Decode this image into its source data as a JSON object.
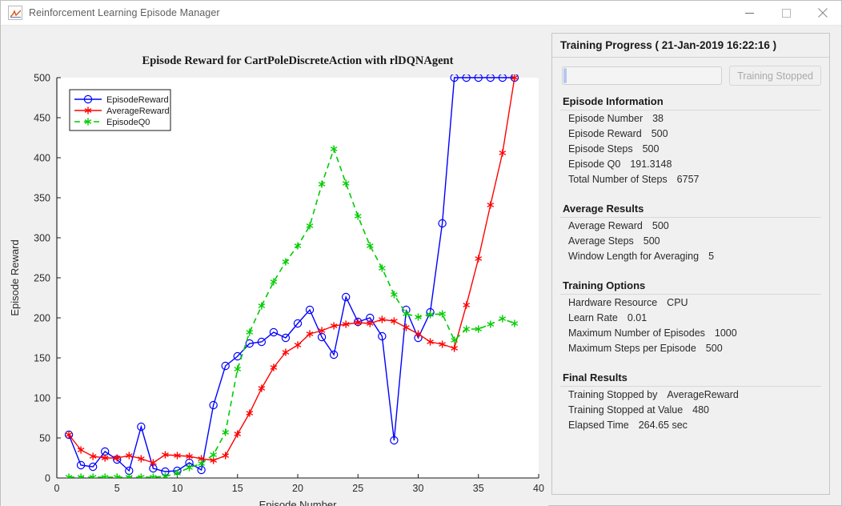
{
  "window": {
    "title": "Reinforcement Learning Episode Manager",
    "app_icon": "matlab-figure-icon",
    "minimize_label": "—",
    "maximize_label": "□",
    "close_label": "✕"
  },
  "panel": {
    "header": "Training Progress ( 21-Jan-2019 16:22:16 )",
    "progress_percent": 2,
    "stop_button_label": "Training Stopped",
    "sections": [
      {
        "title": "Episode Information",
        "rows": [
          {
            "key": "Episode Number",
            "value": "38"
          },
          {
            "key": "Episode Reward",
            "value": "500"
          },
          {
            "key": "Episode Steps",
            "value": "500"
          },
          {
            "key": "Episode Q0",
            "value": "191.3148"
          },
          {
            "key": "Total Number of Steps",
            "value": "6757"
          }
        ]
      },
      {
        "title": "Average Results",
        "rows": [
          {
            "key": "Average Reward",
            "value": "500"
          },
          {
            "key": "Average Steps",
            "value": "500"
          },
          {
            "key": "Window Length for Averaging",
            "value": "5"
          }
        ]
      },
      {
        "title": "Training Options",
        "rows": [
          {
            "key": "Hardware Resource",
            "value": "CPU"
          },
          {
            "key": "Learn Rate",
            "value": "0.01"
          },
          {
            "key": "Maximum Number of Episodes",
            "value": "1000"
          },
          {
            "key": "Maximum Steps per Episode",
            "value": "500"
          }
        ]
      },
      {
        "title": "Final Results",
        "rows": [
          {
            "key": "Training Stopped by",
            "value": "AverageReward"
          },
          {
            "key": "Training Stopped at Value",
            "value": "480"
          },
          {
            "key": "Elapsed Time",
            "value": "264.65 sec"
          }
        ]
      }
    ]
  },
  "chart_data": {
    "type": "line",
    "title": "Episode Reward for CartPoleDiscreteAction with rlDQNAgent",
    "xlabel": "Episode Number",
    "ylabel": "Episode Reward",
    "xlim": [
      0,
      40
    ],
    "ylim": [
      0,
      500
    ],
    "xticks": [
      0,
      5,
      10,
      15,
      20,
      25,
      30,
      35,
      40
    ],
    "yticks": [
      0,
      50,
      100,
      150,
      200,
      250,
      300,
      350,
      400,
      450,
      500
    ],
    "grid": false,
    "legend_position": "upper-left",
    "colors": {
      "EpisodeReward": "#0000ff",
      "AverageReward": "#ff0000",
      "EpisodeQ0": "#00cc00"
    },
    "x": [
      1,
      2,
      3,
      4,
      5,
      6,
      7,
      8,
      9,
      10,
      11,
      12,
      13,
      14,
      15,
      16,
      17,
      18,
      19,
      20,
      21,
      22,
      23,
      24,
      25,
      26,
      27,
      28,
      29,
      30,
      31,
      32,
      33,
      34,
      35,
      36,
      37,
      38
    ],
    "series": [
      {
        "name": "EpisodeReward",
        "color": "#0000ff",
        "marker": "circle",
        "dash": "solid",
        "values": [
          54,
          16,
          14,
          33,
          23,
          9,
          64,
          12,
          8,
          9,
          19,
          10,
          91,
          140,
          152,
          168,
          170,
          182,
          175,
          193,
          210,
          176,
          154,
          226,
          195,
          200,
          177,
          47,
          210,
          175,
          207,
          318,
          500,
          500,
          500,
          500,
          500,
          500
        ]
      },
      {
        "name": "AverageReward",
        "color": "#ff0000",
        "marker": "asterisk",
        "dash": "solid",
        "values": [
          54,
          35,
          27,
          25,
          25,
          28,
          24,
          19,
          29,
          28,
          27,
          24,
          22,
          28,
          55,
          81,
          112,
          138,
          157,
          166,
          180,
          184,
          190,
          192,
          194,
          193,
          198,
          196,
          188,
          180,
          170,
          167,
          162,
          216,
          274,
          341,
          406,
          500
        ]
      },
      {
        "name": "EpisodeQ0",
        "color": "#00cc00",
        "marker": "asterisk",
        "dash": "dashed",
        "values": [
          1,
          1,
          1,
          1,
          1,
          1,
          1,
          1,
          2,
          6,
          13,
          18,
          29,
          57,
          136,
          182,
          215,
          245,
          270,
          290,
          315,
          367,
          411,
          368,
          327,
          290,
          262,
          229,
          205,
          201,
          204,
          205,
          172,
          186,
          186,
          192,
          199,
          193
        ]
      }
    ]
  }
}
